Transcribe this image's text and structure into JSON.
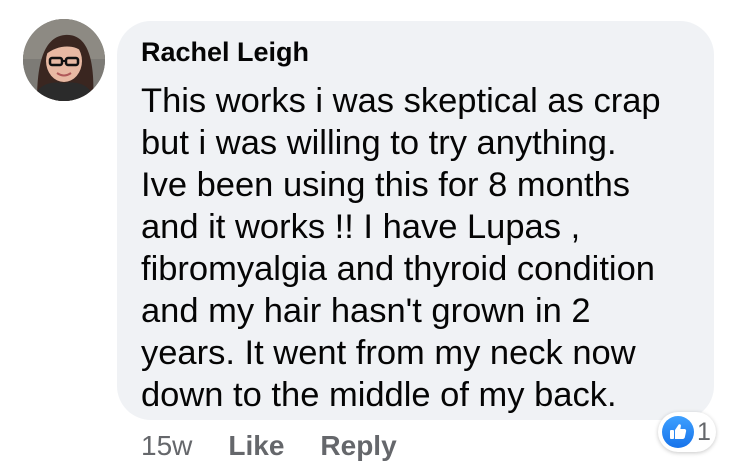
{
  "comment": {
    "author": "Rachel Leigh",
    "body_lines": [
      "This works i was skeptical as crap",
      "but i was willing to try anything.",
      "Ive been using this for 8 months",
      "and it works !! I have Lupas ,",
      "fibromyalgia and thyroid condition",
      "and my hair hasn't grown in 2",
      "years. It went from my neck now",
      "down to the middle of my back."
    ],
    "timestamp": "15w",
    "like_label": "Like",
    "reply_label": "Reply",
    "reaction": {
      "icon": "thumbs-up-icon",
      "count": "1",
      "color": "#1877f2"
    }
  },
  "colors": {
    "bubble": "#f0f2f5",
    "text": "#050505",
    "secondary_text": "#65676b"
  }
}
